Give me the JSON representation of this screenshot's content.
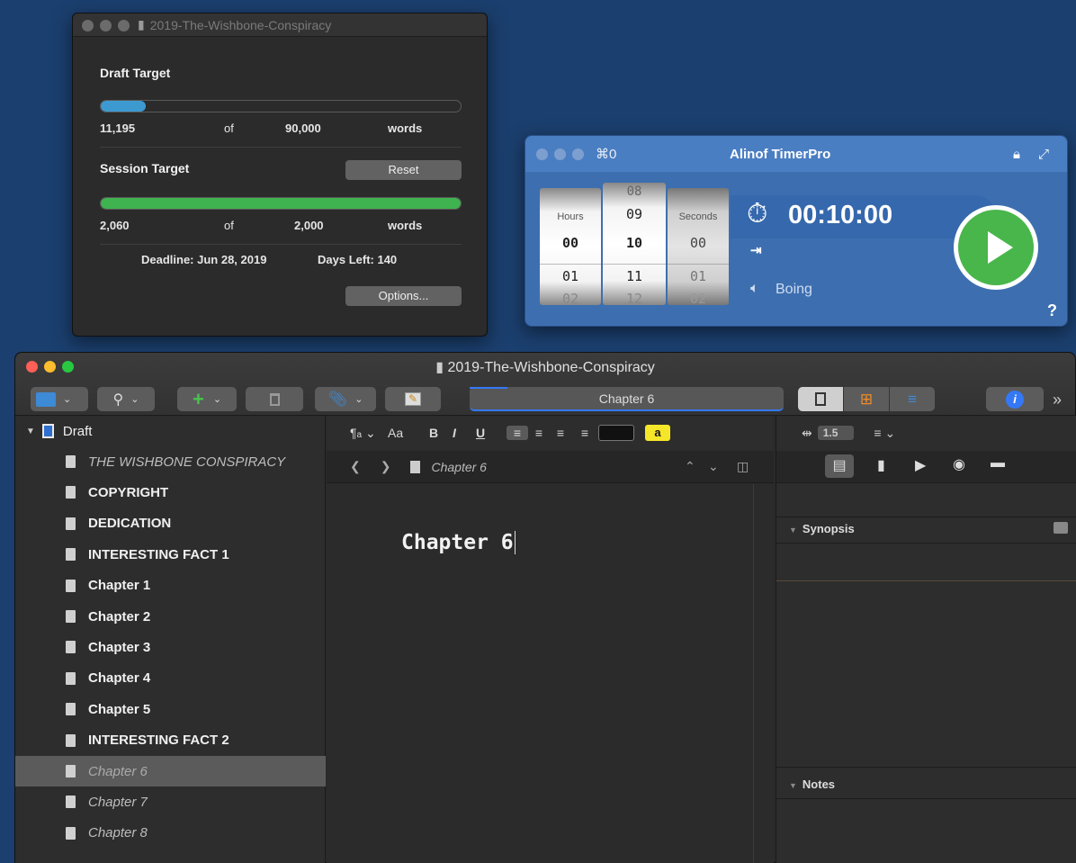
{
  "targets": {
    "window_title": "2019-The-Wishbone-Conspiracy",
    "draft_label": "Draft Target",
    "draft_count": "11,195",
    "of": "of",
    "draft_goal": "90,000",
    "words": "words",
    "draft_progress": 0.124,
    "session_label": "Session Target",
    "reset_label": "Reset",
    "session_count": "2,060",
    "session_goal": "2,000",
    "session_progress": 1.0,
    "deadline": "Deadline: Jun 28, 2019",
    "days_left": "Days Left: 140",
    "options_label": "Options..."
  },
  "timer": {
    "shortcut": "⌘0",
    "title": "Alinof TimerPro",
    "hours_label": "Hours",
    "seconds_label": "Seconds",
    "hours": [
      "00",
      "01",
      "02"
    ],
    "minutes": [
      "08",
      "09",
      "10",
      "11",
      "12"
    ],
    "seconds": [
      "00",
      "01",
      "02"
    ],
    "time": "00:10:00",
    "sound": "Boing",
    "help": "?"
  },
  "main": {
    "title": "2019-The-Wishbone-Conspiracy",
    "document_title": "Chapter 6",
    "colors": {
      "accent": "#3478f6",
      "progress_green": "#3fb34f",
      "progress_blue": "#3d9ad1"
    }
  },
  "binder": {
    "root": "Draft",
    "items": [
      {
        "label": "THE WISHBONE CONSPIRACY",
        "style": "italic"
      },
      {
        "label": "COPYRIGHT",
        "style": "bold"
      },
      {
        "label": "DEDICATION",
        "style": "bold"
      },
      {
        "label": "INTERESTING FACT 1",
        "style": "bold"
      },
      {
        "label": "Chapter 1",
        "style": "bold"
      },
      {
        "label": "Chapter 2",
        "style": "bold"
      },
      {
        "label": "Chapter 3",
        "style": "bold"
      },
      {
        "label": "Chapter 4",
        "style": "bold"
      },
      {
        "label": "Chapter 5",
        "style": "bold"
      },
      {
        "label": "INTERESTING FACT 2",
        "style": "bold"
      },
      {
        "label": "Chapter 6",
        "style": "italic-selected"
      },
      {
        "label": "Chapter 7",
        "style": "italic"
      },
      {
        "label": "Chapter 8",
        "style": "italic"
      }
    ]
  },
  "format_bar": {
    "aa": "Aa",
    "bold": "B",
    "italic": "I",
    "underline": "U",
    "highlight": "a",
    "line_spacing": "1.5"
  },
  "editor": {
    "header_title": "Chapter 6",
    "body": "Chapter 6"
  },
  "inspector": {
    "synopsis": "Synopsis",
    "notes": "Notes"
  }
}
